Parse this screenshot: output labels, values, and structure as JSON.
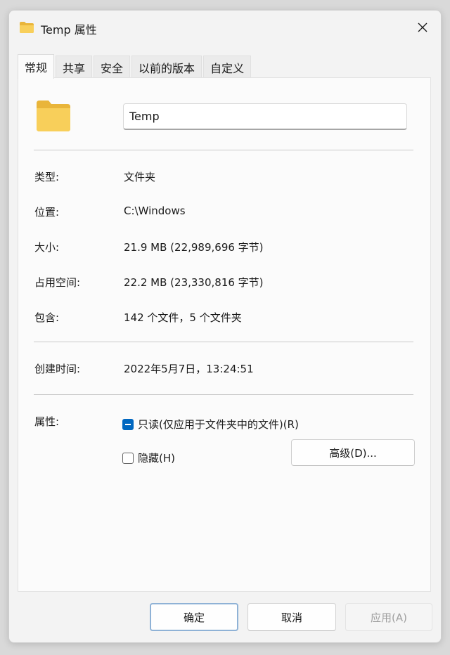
{
  "window": {
    "title": "Temp 属性",
    "icon": "folder-icon",
    "close_icon": "close-icon"
  },
  "tabs": [
    {
      "label": "常规",
      "active": true
    },
    {
      "label": "共享",
      "active": false
    },
    {
      "label": "安全",
      "active": false
    },
    {
      "label": "以前的版本",
      "active": false
    },
    {
      "label": "自定义",
      "active": false
    }
  ],
  "general": {
    "folder_name": "Temp",
    "type_label": "类型:",
    "type_value": "文件夹",
    "location_label": "位置:",
    "location_value": "C:\\Windows",
    "size_label": "大小:",
    "size_value": "21.9 MB (22,989,696 字节)",
    "size_on_disk_label": "占用空间:",
    "size_on_disk_value": "22.2 MB (23,330,816 字节)",
    "contains_label": "包含:",
    "contains_value": "142 个文件，5 个文件夹",
    "created_label": "创建时间:",
    "created_value": "2022年5月7日，13:24:51",
    "attributes_label": "属性:",
    "readonly_label": "只读(仅应用于文件夹中的文件)(R)",
    "readonly_state": "indeterminate",
    "hidden_label": "隐藏(H)",
    "hidden_state": "unchecked",
    "advanced_label": "高级(D)..."
  },
  "footer": {
    "ok_label": "确定",
    "cancel_label": "取消",
    "apply_label": "应用(A)"
  },
  "colors": {
    "accent": "#0067c0",
    "folder": "#f8c94a"
  }
}
